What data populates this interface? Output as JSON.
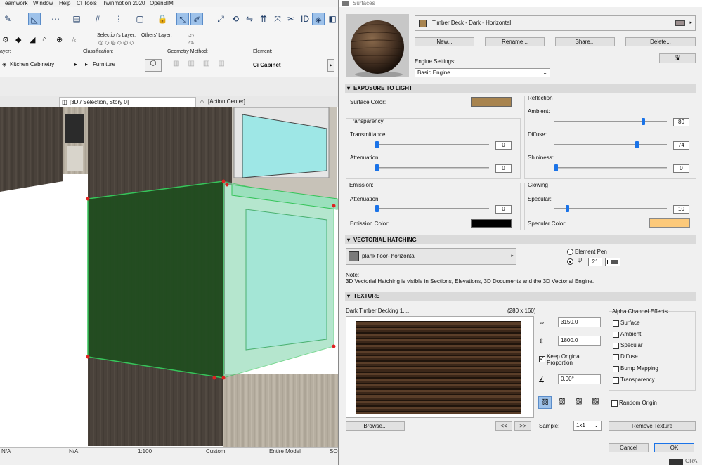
{
  "menu": [
    "Teamwork",
    "Window",
    "Help",
    "CI Tools",
    "Twinmotion 2020",
    "OpenBIM"
  ],
  "infobar": {
    "selection_layer_label": "Selection's Layer:",
    "others_layer_label": "Others' Layer:",
    "layer_label": "ayer:",
    "layer_value": "Kitchen Cabinetry",
    "classification_label": "Classification:",
    "classification_value": "Furniture",
    "geometry_label": "Geometry Method:",
    "element_label": "Element:",
    "element_value": "Ci Cabinet"
  },
  "tabs": {
    "view_tab": "[3D / Selection, Story 0]",
    "action_tab": "[Action Center]"
  },
  "statusbar": {
    "na1": "N/A",
    "na2": "N/A",
    "scale": "1:100",
    "custom": "Custom",
    "model": "Entire Model",
    "so": "SO"
  },
  "dialog": {
    "title": "Surfaces",
    "surface_name": "Timber Deck - Dark - Horizontal",
    "buttons": {
      "new": "New...",
      "rename": "Rename...",
      "share": "Share...",
      "delete": "Delete..."
    },
    "engine_settings_label": "Engine Settings:",
    "engine_value": "Basic Engine",
    "exposure": {
      "header": "EXPOSURE TO LIGHT",
      "surface_color_label": "Surface Color:",
      "transparency_label": "Transparency",
      "transmittance_label": "Transmittance:",
      "transmittance_value": "0",
      "attenuation_label": "Attenuation:",
      "attenuation_value": "0",
      "reflection_label": "Reflection",
      "ambient_label": "Ambient:",
      "ambient_value": "80",
      "diffuse_label": "Diffuse:",
      "diffuse_value": "74",
      "shininess_label": "Shininess:",
      "shininess_value": "0",
      "emission_label": "Emission:",
      "emission_attenuation_label": "Attenuation:",
      "emission_attenuation_value": "0",
      "emission_color_label": "Emission Color:",
      "glowing_label": "Glowing",
      "specular_label": "Specular:",
      "specular_value": "10",
      "specular_color_label": "Specular Color:"
    },
    "hatching": {
      "header": "VECTORIAL HATCHING",
      "pattern": "plank floor- horizontal",
      "element_pen_label": "Element Pen",
      "pen_number": "21",
      "note_title": "Note:",
      "note_text": "3D Vectorial Hatching is visible in Sections, Elevations, 3D Documents and the 3D Vectorial Engine."
    },
    "texture": {
      "header": "TEXTURE",
      "name": "Dark Timber Decking 1....",
      "size": "(280 x 160)",
      "width": "3150.0",
      "height": "1800.0",
      "keep_proportion": "Keep Original Proportion",
      "angle": "0.00°",
      "browse": "Browse...",
      "prev": "<<",
      "next": ">>",
      "sample_label": "Sample:",
      "sample_value": "1x1",
      "remove": "Remove Texture",
      "random_origin": "Random Origin",
      "alpha": {
        "title": "Alpha Channel Effects",
        "items": [
          "Surface",
          "Ambient",
          "Specular",
          "Diffuse",
          "Bump Mapping",
          "Transparency"
        ]
      }
    },
    "cancel": "Cancel",
    "ok": "OK"
  },
  "colors": {
    "surface_color": "#a8844f",
    "emission_color": "#000000",
    "specular_color": "#fcc97a",
    "accent": "#1a73e8"
  },
  "progress": {
    "transmittance": 0,
    "attenuation": 0,
    "ambient": 80,
    "diffuse": 74,
    "shininess": 0,
    "emission_attenuation": 0,
    "specular": 10
  },
  "footer_text": "GRA"
}
